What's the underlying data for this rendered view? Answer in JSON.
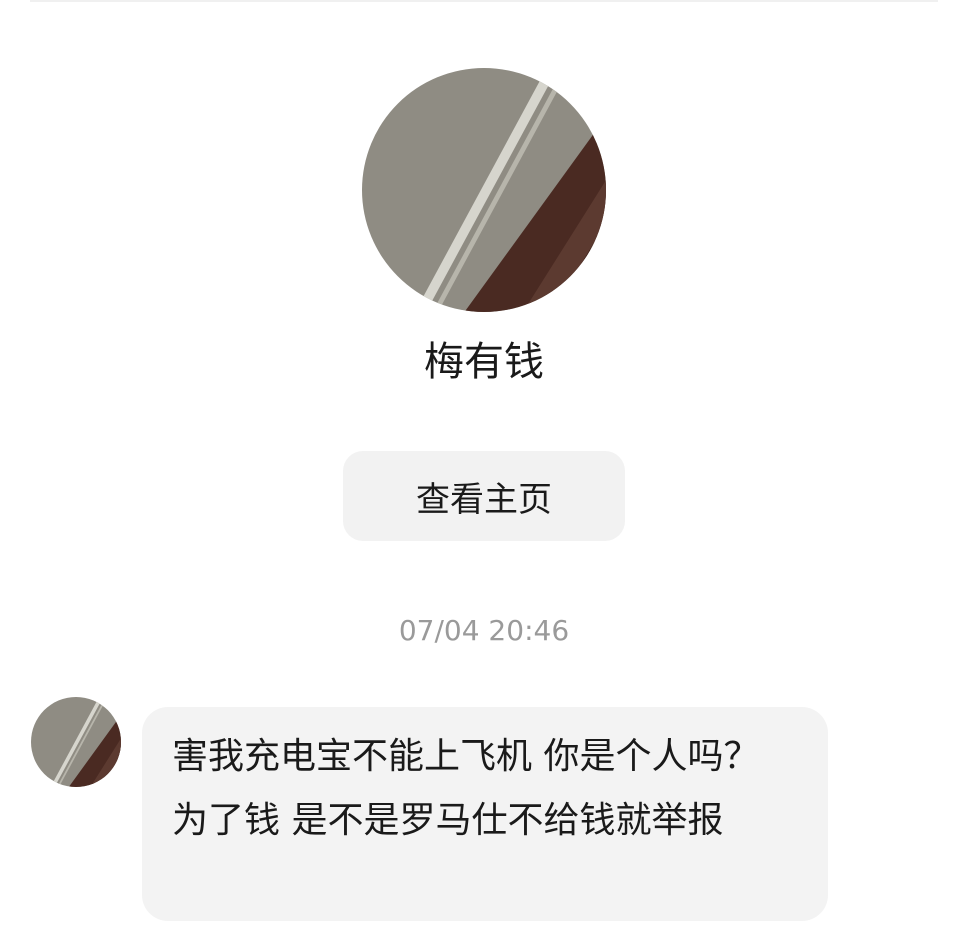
{
  "profile": {
    "name": "梅有钱",
    "view_profile_label": "查看主页",
    "avatar": "profile-photo"
  },
  "conversation": {
    "timestamp": "07/04 20:46",
    "messages": [
      {
        "sender": "梅有钱",
        "text": "害我充电宝不能上飞机 你是个人吗？ 为了钱 是不是罗马仕不给钱就举报"
      }
    ]
  },
  "colors": {
    "background": "#ffffff",
    "bubble": "#f3f3f3",
    "button": "#f2f2f2",
    "text_primary": "#1a1a1a",
    "text_secondary": "#9a9a9a"
  }
}
